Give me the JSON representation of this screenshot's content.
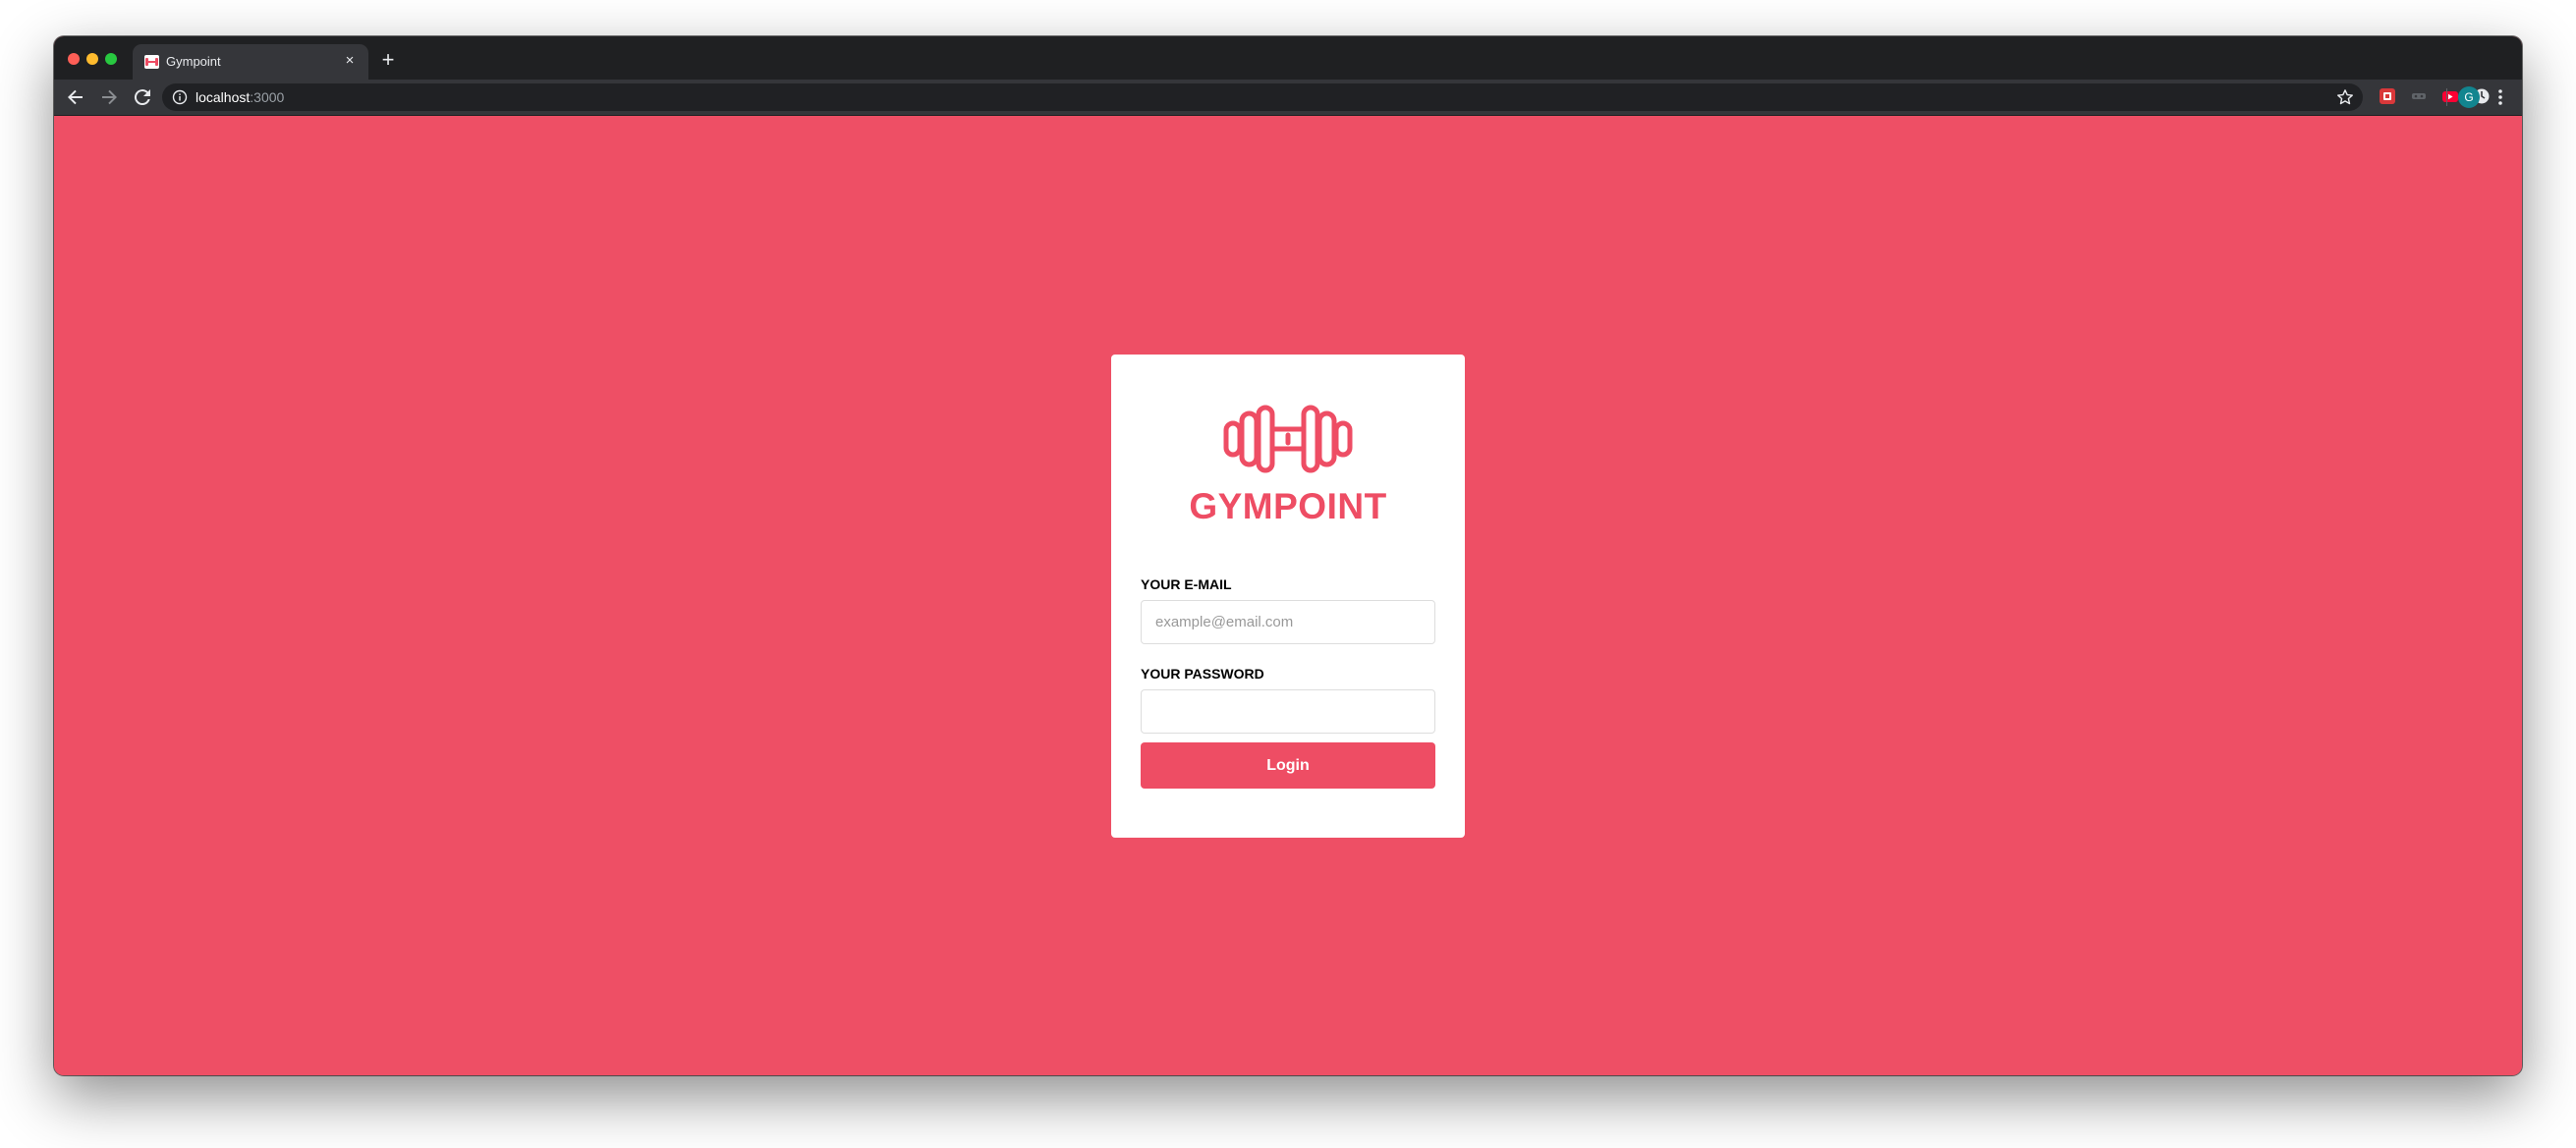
{
  "browser": {
    "tab": {
      "title": "Gympoint",
      "favicon": "dumbbell-favicon",
      "close_label": "×"
    },
    "new_tab_label": "+",
    "address": {
      "host": "localhost",
      "port": ":3000"
    },
    "icons": {
      "back": "arrow-left-icon",
      "forward": "arrow-right-icon",
      "reload": "reload-icon",
      "info": "info-icon",
      "bookmark": "star-icon",
      "menu": "kebab-menu-icon"
    },
    "extensions": [
      "red-square-extension-icon",
      "grey-extension-icon",
      "youtube-extension-icon",
      "clock-extension-icon"
    ],
    "profile_initial": "G",
    "colors": {
      "tabbar_bg": "#1f2022",
      "toolbar_bg": "#35363a",
      "profile_bg": "#12858f"
    }
  },
  "login": {
    "logo": "dumbbell-logo-icon",
    "brand_name": "GYMPOINT",
    "email_label": "YOUR E-MAIL",
    "email_placeholder": "example@email.com",
    "email_value": "",
    "password_label": "YOUR PASSWORD",
    "password_value": "",
    "submit_label": "Login"
  },
  "colors": {
    "page_background": "#ee4f65",
    "brand": "#ee4d64",
    "card_background": "#ffffff"
  }
}
